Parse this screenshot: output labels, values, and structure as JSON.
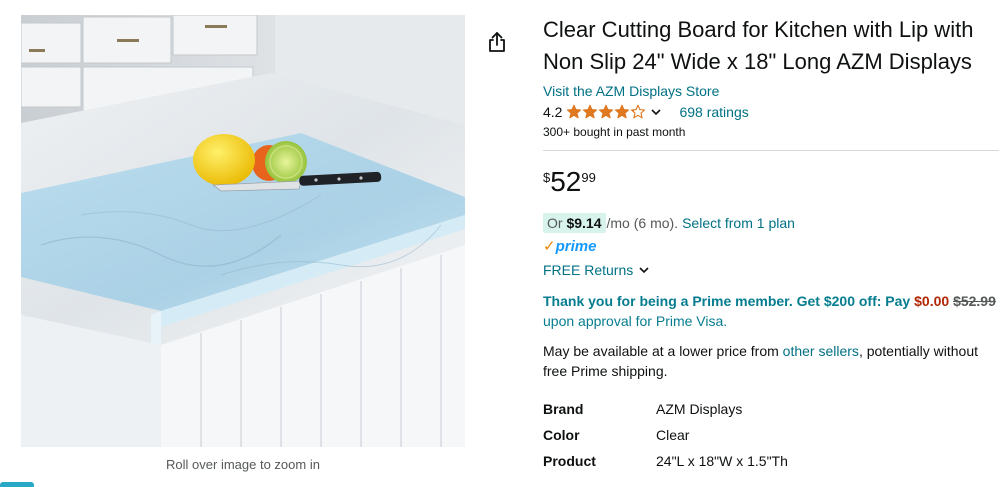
{
  "image": {
    "zoom_hint": "Roll over image to zoom in"
  },
  "product": {
    "title": "Clear Cutting Board for Kitchen with Lip with Non Slip 24\" Wide x 18\" Long AZM Displays",
    "store_link": "Visit the AZM Displays Store",
    "rating_value": "4.2",
    "rating_stars": 4.2,
    "ratings_count": "698 ratings",
    "bought_text": "300+ bought in past month"
  },
  "price": {
    "symbol": "$",
    "whole": "52",
    "fraction": "99"
  },
  "monthly": {
    "or_label": "Or",
    "amount": "$9.14",
    "mo_text": "/mo (6 mo).",
    "plan_link": "Select from 1 plan"
  },
  "prime": {
    "check": "✓",
    "word": "prime"
  },
  "returns": {
    "label": "FREE Returns"
  },
  "prime_visa": {
    "lead": "Thank you for being a Prime member. Get $200 off: Pay",
    "new_price": "$0.00",
    "old_price": "$52.99",
    "approval": "upon approval for Prime Visa."
  },
  "sellers": {
    "before": "May be available at a lower price from",
    "link": "other sellers",
    "after": ", potentially without free Prime shipping."
  },
  "specs": [
    {
      "key": "Brand",
      "value": "AZM Displays"
    },
    {
      "key": "Color",
      "value": "Clear"
    },
    {
      "key": "Product",
      "value": "24\"L x 18\"W x 1.5\"Th"
    }
  ],
  "colors": {
    "link": "#007185",
    "prime_blue": "#1399ff",
    "prime_orange": "#f08804",
    "star": "#de7921",
    "price_red": "#b12704",
    "deal_pill": "#d7f3ec"
  },
  "icons": {
    "share": "share-icon",
    "chevron": "chevron-down-icon"
  }
}
